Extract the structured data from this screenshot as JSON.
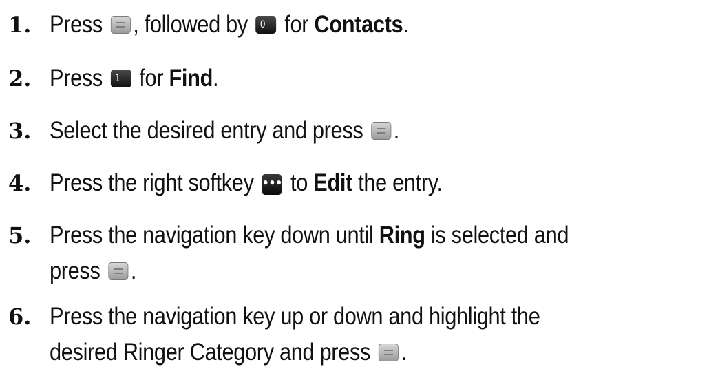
{
  "steps": [
    {
      "number": "1.",
      "parts": [
        {
          "t": "Press "
        },
        {
          "icon": "menu-ok-key-icon"
        },
        {
          "t": ", followed by "
        },
        {
          "icon": "zero-next-key-icon",
          "glyph": "0"
        },
        {
          "t": " for "
        },
        {
          "b": "Contacts"
        },
        {
          "t": "."
        }
      ]
    },
    {
      "number": "2.",
      "parts": [
        {
          "t": "Press "
        },
        {
          "icon": "one-key-icon",
          "glyph": "1"
        },
        {
          "t": "  for "
        },
        {
          "b": "Find"
        },
        {
          "t": "."
        }
      ]
    },
    {
      "number": "3.",
      "parts": [
        {
          "t": "Select the desired entry and press "
        },
        {
          "icon": "menu-ok-key-icon"
        },
        {
          "t": "."
        }
      ]
    },
    {
      "number": "4.",
      "parts": [
        {
          "t": "Press the right softkey "
        },
        {
          "icon": "right-softkey-icon",
          "glyph": "•••"
        },
        {
          "t": " to "
        },
        {
          "b": "Edit"
        },
        {
          "t": " the entry."
        }
      ]
    },
    {
      "number": "5.",
      "lines": [
        [
          {
            "t": "Press the navigation key down until "
          },
          {
            "b": "Ring"
          },
          {
            "t": " is selected and"
          }
        ],
        [
          {
            "t": "press "
          },
          {
            "icon": "menu-ok-key-icon"
          },
          {
            "t": "."
          }
        ]
      ]
    },
    {
      "number": "6.",
      "lines": [
        [
          {
            "t": "Press the navigation key up or down and highlight the"
          }
        ],
        [
          {
            "t": "desired Ringer Category and press "
          },
          {
            "icon": "menu-ok-key-icon"
          },
          {
            "t": "."
          }
        ]
      ]
    }
  ]
}
